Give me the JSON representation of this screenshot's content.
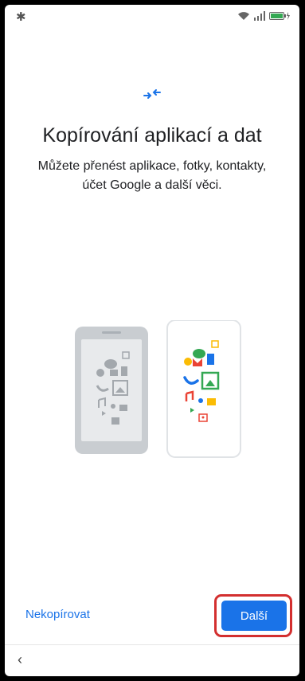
{
  "status_bar": {
    "icons": [
      "bluetooth-icon",
      "wifi-icon",
      "signal-icon",
      "battery-charging-icon"
    ]
  },
  "header": {
    "icon": "transfer-arrows-icon",
    "title": "Kopírování aplikací a dat",
    "subtitle": "Můžete přenést aplikace, fotky, kontakty, účet Google a další věci."
  },
  "illustration": {
    "icon": "phone-to-phone-transfer-illustration",
    "colors": {
      "blue": "#1a73e8",
      "red": "#ea4335",
      "yellow": "#fbbc04",
      "green": "#34a853",
      "old_phone": "#cfd3d7"
    }
  },
  "footer": {
    "skip_label": "Nekopírovat",
    "next_label": "Další",
    "highlight_color": "#d32f2f"
  },
  "nav_bar": {
    "back_icon": "chevron-left-icon"
  }
}
